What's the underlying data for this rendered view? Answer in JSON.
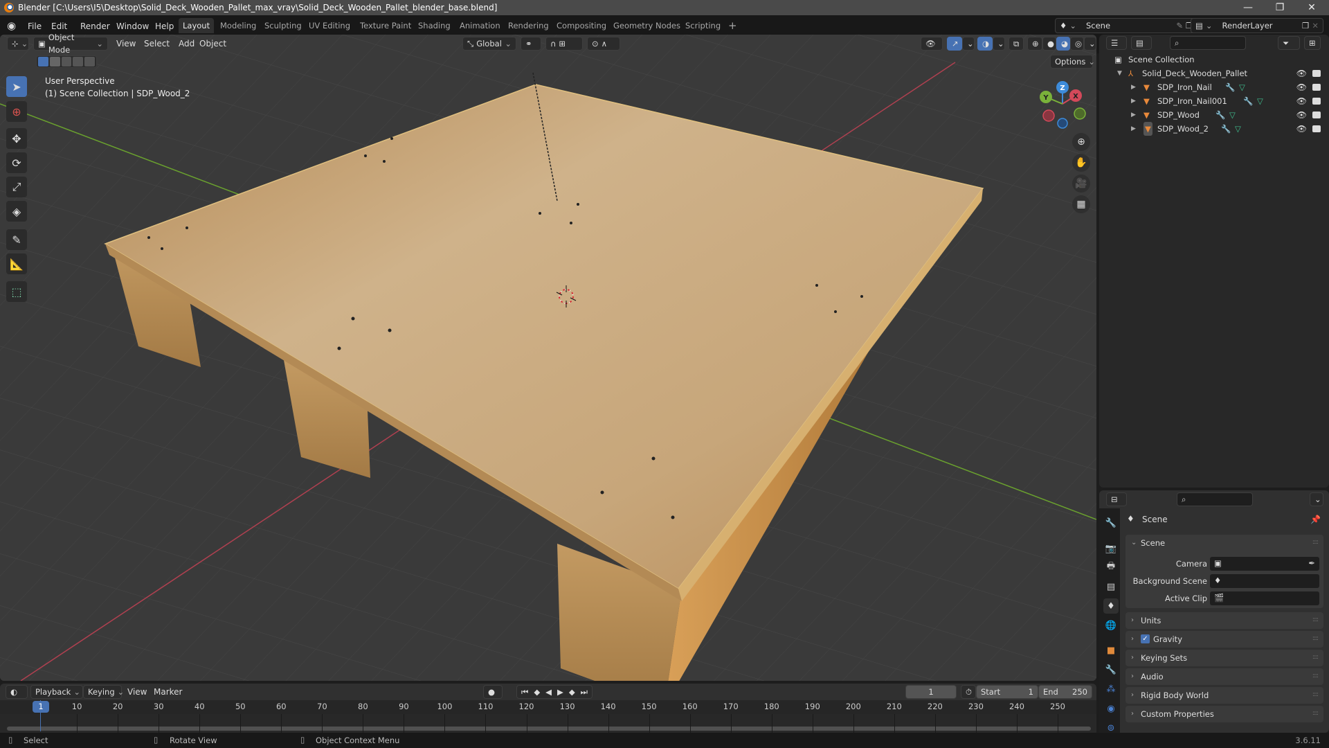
{
  "window": {
    "title": "Blender [C:\\Users\\I5\\Desktop\\Solid_Deck_Wooden_Pallet_max_vray\\Solid_Deck_Wooden_Pallet_blender_base.blend]",
    "controls": {
      "minimize": "—",
      "maximize": "❐",
      "close": "✕"
    }
  },
  "menubar": {
    "items": [
      "File",
      "Edit",
      "Render",
      "Window",
      "Help"
    ],
    "workspaces": [
      "Layout",
      "Modeling",
      "Sculpting",
      "UV Editing",
      "Texture Paint",
      "Shading",
      "Animation",
      "Rendering",
      "Compositing",
      "Geometry Nodes",
      "Scripting"
    ],
    "active_workspace": "Layout",
    "add_workspace": "+",
    "scene_name": "Scene",
    "view_layer": "RenderLayer"
  },
  "viewport": {
    "mode": "Object Mode",
    "menus": [
      "View",
      "Select",
      "Add",
      "Object"
    ],
    "transform_orientation": "Global",
    "options_label": "Options",
    "overlay_line1": "User Perspective",
    "overlay_line2": "(1) Scene Collection | SDP_Wood_2",
    "gizmo_axes": {
      "x": "X",
      "y": "Y",
      "z": "Z"
    },
    "colors": {
      "x_axis": "#d4495a",
      "y_axis": "#7ab23a",
      "z_axis": "#3d8bd9",
      "accent": "#4772b3",
      "grid_bg": "#3a3a3a"
    }
  },
  "outliner": {
    "root": "Scene Collection",
    "collection": "Solid_Deck_Wooden_Pallet",
    "objects": [
      {
        "name": "SDP_Iron_Nail",
        "selected": false
      },
      {
        "name": "SDP_Iron_Nail001",
        "selected": false
      },
      {
        "name": "SDP_Wood",
        "selected": false
      },
      {
        "name": "SDP_Wood_2",
        "selected": true
      }
    ]
  },
  "properties": {
    "context_title": "Scene",
    "scene_panel": {
      "title": "Scene",
      "camera_label": "Camera",
      "camera_value": "",
      "background_scene_label": "Background Scene",
      "background_scene_value": "",
      "active_clip_label": "Active Clip",
      "active_clip_value": ""
    },
    "panels": [
      {
        "title": "Units"
      },
      {
        "title": "Gravity",
        "checkbox": true
      },
      {
        "title": "Keying Sets"
      },
      {
        "title": "Audio"
      },
      {
        "title": "Rigid Body World"
      },
      {
        "title": "Custom Properties"
      }
    ]
  },
  "timeline": {
    "menus": [
      "Playback",
      "Keying",
      "View",
      "Marker"
    ],
    "current_frame": "1",
    "start_label": "Start",
    "start": "1",
    "end_label": "End",
    "end": "250",
    "ruler": [
      "10",
      "20",
      "30",
      "40",
      "50",
      "60",
      "70",
      "80",
      "90",
      "100",
      "110",
      "120",
      "130",
      "140",
      "150",
      "160",
      "170",
      "180",
      "190",
      "200",
      "210",
      "220",
      "230",
      "240",
      "250"
    ]
  },
  "statusbar": {
    "hints": [
      "Select",
      "Rotate View",
      "Object Context Menu"
    ],
    "version": "3.6.11"
  }
}
